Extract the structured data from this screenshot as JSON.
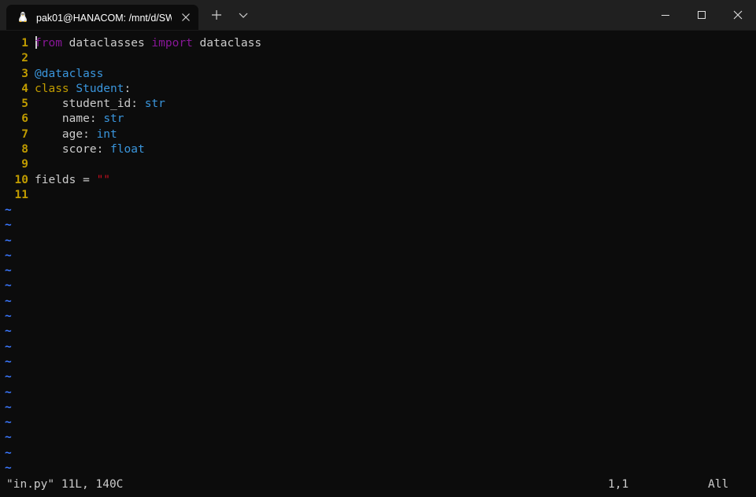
{
  "window": {
    "tab_title": "pak01@HANACOM: /mnt/d/SW",
    "tab_icon": "linux-penguin-icon",
    "new_tab_icon": "plus-icon",
    "dropdown_icon": "chevron-down-icon",
    "controls": [
      "minimize-icon",
      "maximize-icon",
      "close-icon"
    ]
  },
  "editor": {
    "lines": [
      {
        "num": "1",
        "parts": [
          {
            "t": "from",
            "c": "kw"
          },
          {
            "t": " dataclasses ",
            "c": "plain"
          },
          {
            "t": "import",
            "c": "kw"
          },
          {
            "t": " dataclass",
            "c": "plain"
          }
        ]
      },
      {
        "num": "2",
        "parts": []
      },
      {
        "num": "3",
        "parts": [
          {
            "t": "@dataclass",
            "c": "dec"
          }
        ]
      },
      {
        "num": "4",
        "parts": [
          {
            "t": "class",
            "c": "cls"
          },
          {
            "t": " ",
            "c": "plain"
          },
          {
            "t": "Student",
            "c": "name"
          },
          {
            "t": ":",
            "c": "plain"
          }
        ]
      },
      {
        "num": "5",
        "parts": [
          {
            "t": "    student_id: ",
            "c": "plain"
          },
          {
            "t": "str",
            "c": "ty"
          }
        ]
      },
      {
        "num": "6",
        "parts": [
          {
            "t": "    name: ",
            "c": "plain"
          },
          {
            "t": "str",
            "c": "ty"
          }
        ]
      },
      {
        "num": "7",
        "parts": [
          {
            "t": "    age: ",
            "c": "plain"
          },
          {
            "t": "int",
            "c": "ty"
          }
        ]
      },
      {
        "num": "8",
        "parts": [
          {
            "t": "    score: ",
            "c": "plain"
          },
          {
            "t": "float",
            "c": "ty"
          }
        ]
      },
      {
        "num": "9",
        "parts": []
      },
      {
        "num": "10",
        "parts": [
          {
            "t": "fields = ",
            "c": "plain"
          },
          {
            "t": "\"\"",
            "c": "str"
          }
        ]
      },
      {
        "num": "11",
        "parts": []
      }
    ],
    "tilde_char": "~",
    "tilde_count": 18
  },
  "status": {
    "file_info": "\"in.py\" 11L, 140C",
    "cursor_pos": "1,1",
    "scroll": "All"
  },
  "colors": {
    "background": "#0c0c0c",
    "titlebar": "#202020",
    "line_number": "#c19c00",
    "keyword": "#881798",
    "type": "#3a96dd",
    "string": "#c50f1f",
    "tilde": "#3b78ff"
  }
}
